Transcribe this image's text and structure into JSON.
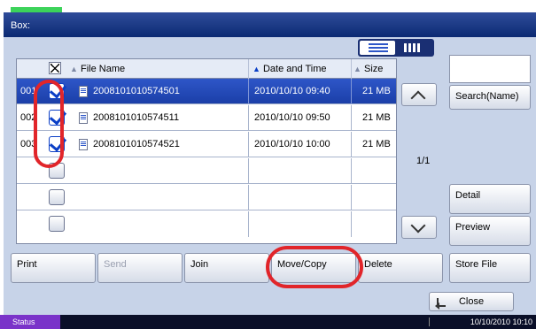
{
  "window": {
    "title": "Box:"
  },
  "table": {
    "headers": {
      "file_name": "File Name",
      "date_time": "Date and Time",
      "size": "Size"
    },
    "rows": [
      {
        "num": "001",
        "file_name": "2008101010574501",
        "date_time": "2010/10/10 09:40",
        "size": "21 MB",
        "checked": true,
        "selected": true
      },
      {
        "num": "002",
        "file_name": "2008101010574511",
        "date_time": "2010/10/10 09:50",
        "size": "21 MB",
        "checked": true,
        "selected": false
      },
      {
        "num": "003",
        "file_name": "2008101010574521",
        "date_time": "2010/10/10 10:00",
        "size": "21 MB",
        "checked": true,
        "selected": false
      }
    ],
    "page_indicator": "1/1"
  },
  "side_buttons": {
    "search_name": "Search(Name)",
    "detail": "Detail",
    "preview": "Preview"
  },
  "action_buttons": {
    "print": "Print",
    "send": "Send",
    "join": "Join",
    "move_copy": "Move/Copy",
    "delete": "Delete",
    "store_file": "Store File"
  },
  "close_button": "Close",
  "status": {
    "label": "Status",
    "datetime": "10/10/2010  10:10"
  },
  "colors": {
    "header_blue": "#0b2a73",
    "selection_blue": "#2e56c8",
    "highlight_red": "#e1252a",
    "status_purple": "#7a33c9"
  },
  "icons": [
    "list-view-icon",
    "thumbnail-view-icon",
    "document-icon",
    "chevron-up-icon",
    "chevron-down-icon",
    "return-arrow-icon"
  ]
}
